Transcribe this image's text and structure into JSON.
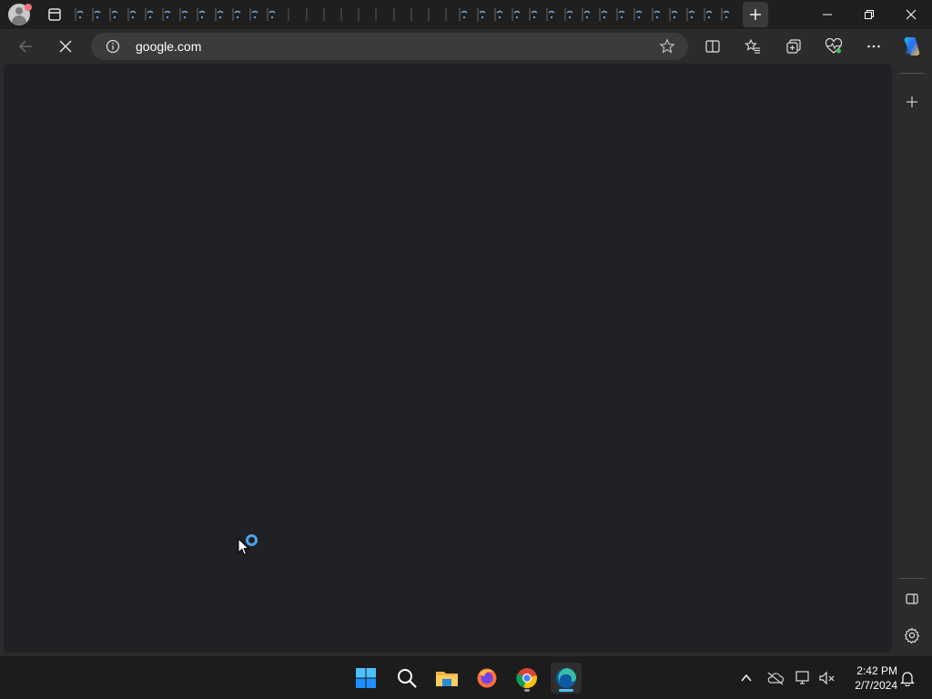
{
  "window": {
    "tab_count": 38,
    "new_tab_label": "+",
    "minimize_icon": "minimize-icon",
    "restore_icon": "restore-icon",
    "close_icon": "close-icon"
  },
  "toolbar": {
    "address": "google.com",
    "back_icon": "back-arrow-icon",
    "stop_icon": "stop-loading-icon",
    "site_info_icon": "info-icon",
    "favorite_icon": "star-icon",
    "split_screen_icon": "split-screen-icon",
    "favorites_icon": "favorites-icon",
    "collections_icon": "collections-icon",
    "performance_icon": "performance-icon",
    "more_icon": "more-icon",
    "copilot_icon": "copilot-icon"
  },
  "sidebar": {
    "add_icon": "plus-icon",
    "hide_icon": "sidebar-toggle-icon",
    "settings_icon": "gear-icon"
  },
  "taskbar": {
    "apps": [
      "start",
      "search",
      "file-explorer",
      "firefox",
      "chrome",
      "edge"
    ],
    "time": "2:42 PM",
    "date": "2/7/2024"
  },
  "colors": {
    "accent": "#4da3e8",
    "content_bg": "#202124",
    "chrome_bg": "#2b2b2b"
  }
}
